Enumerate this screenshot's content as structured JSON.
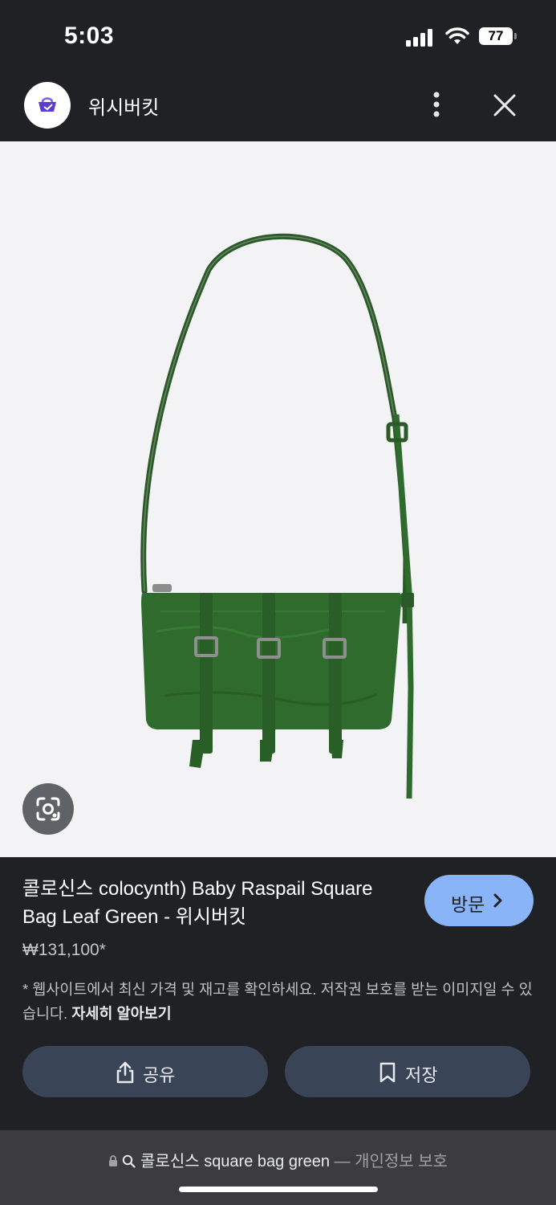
{
  "status_bar": {
    "time": "5:03",
    "battery": "77"
  },
  "header": {
    "title": "위시버킷",
    "logo_icon": "wishbucket-logo-icon",
    "more_icon": "more-vertical-icon",
    "close_icon": "close-icon"
  },
  "image": {
    "subject": "green-leather-shoulder-bag",
    "bag_color": "#2f6b2c",
    "lens_icon": "visual-search-lens-icon"
  },
  "product": {
    "title": "콜로신스 colocynth) Baby Raspail Square Bag Leaf Green - 위시버킷",
    "price": "₩131,100*",
    "visit_label": "방문",
    "disclaimer_text": "* 웹사이트에서 최신 가격 및 재고를 확인하세요. 저작권 보호를 받는 이미지일 수 있습니다. ",
    "learn_more": "자세히 알아보기"
  },
  "actions": {
    "share_label": "공유",
    "save_label": "저장"
  },
  "url_bar": {
    "query": "콜로신스 square bag green",
    "separator": " — ",
    "privacy": "개인정보 보호"
  },
  "colors": {
    "accent": "#8ab4f8",
    "panel": "#202124",
    "action_button": "#394457"
  }
}
